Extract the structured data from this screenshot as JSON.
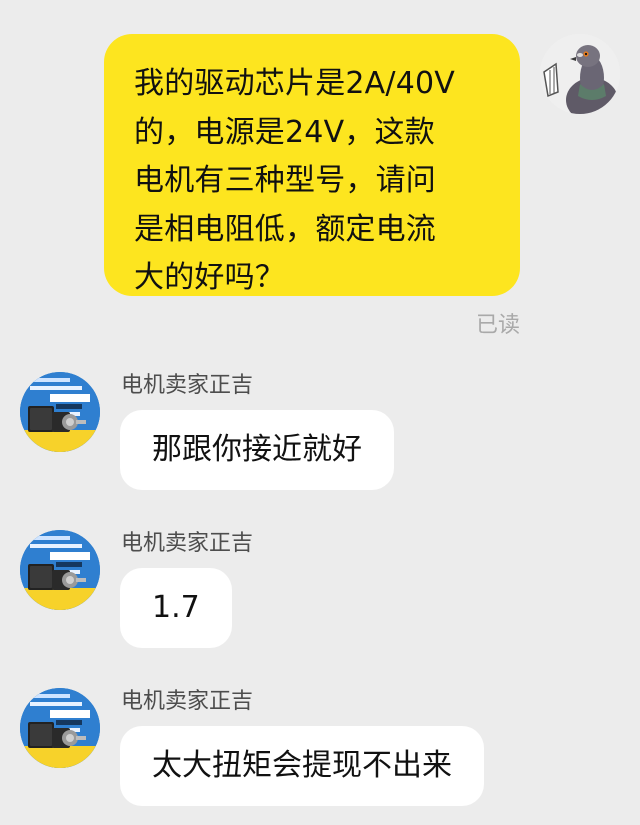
{
  "outgoing": {
    "lines": [
      "我的驱动芯片是2A/40V",
      "的，电源是24V，这款",
      "电机有三种型号，请问",
      "是相电阻低，额定电流",
      "大的好吗？"
    ],
    "status": "已读"
  },
  "incoming": [
    {
      "sender": "电机卖家正吉",
      "text": "那跟你接近就好"
    },
    {
      "sender": "电机卖家正吉",
      "text": "1.7"
    },
    {
      "sender": "电机卖家正吉",
      "text": "太大扭矩会提现不出来"
    }
  ],
  "colors": {
    "background": "#ececec",
    "outgoing_bubble": "#fde51f",
    "incoming_bubble": "#ffffff",
    "status_text": "#a9a9a9"
  },
  "icons": {
    "my_avatar": "pigeon-avatar-icon",
    "seller_avatar": "stepper-motor-avatar-icon"
  }
}
